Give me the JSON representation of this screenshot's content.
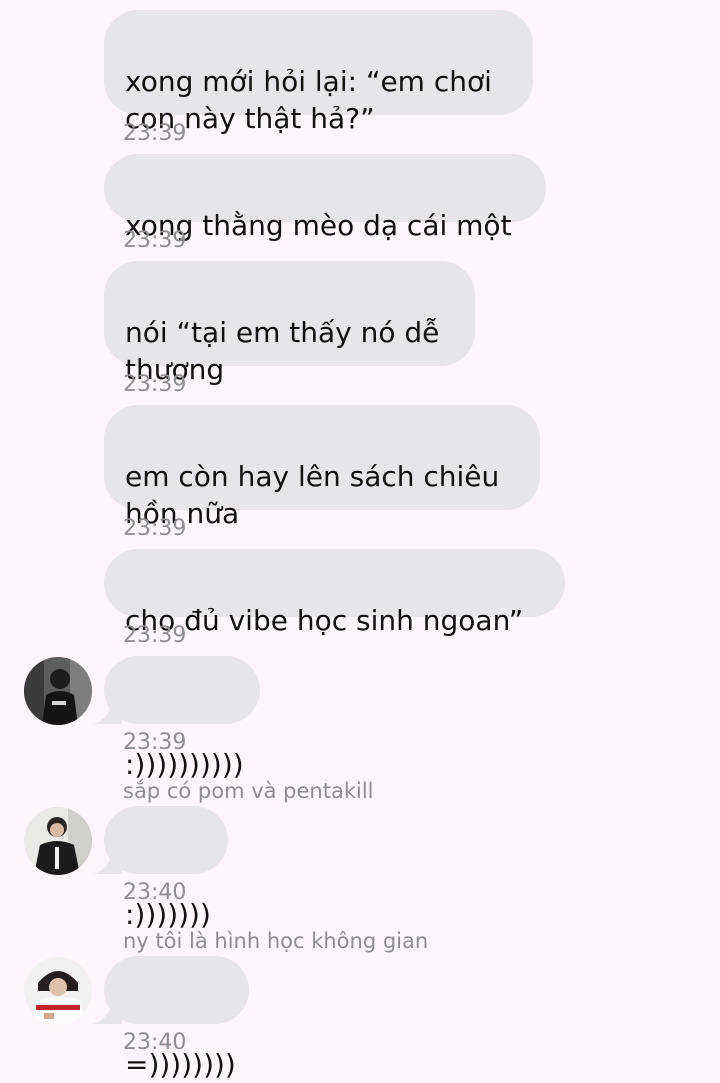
{
  "messages": [
    {
      "text": "xong mới hỏi lại: “em chơi\ncon này thật hả?”",
      "time": "23:39"
    },
    {
      "text": "xong thằng mèo dạ cái một",
      "time": "23:39"
    },
    {
      "text": "nói “tại em thấy nó dễ\nthương",
      "time": "23:39"
    },
    {
      "text": "em còn hay lên sách chiêu\nhồn nữa",
      "time": "23:39"
    },
    {
      "text": "cho đủ vibe học sinh ngoan”",
      "time": "23:39"
    },
    {
      "text": ":))))))))))",
      "time": "23:39"
    },
    {
      "sender": "sắp có pom và pentakill",
      "text": ":)))))))",
      "time": "23:40"
    },
    {
      "sender": "ny tôi là hình học không gian",
      "text": "=))))))))",
      "time": "23:40"
    }
  ],
  "colors": {
    "background": "#fcf6fc",
    "bubble": "#e6e5ea",
    "text": "#111111",
    "meta_text": "#8d8d92"
  }
}
